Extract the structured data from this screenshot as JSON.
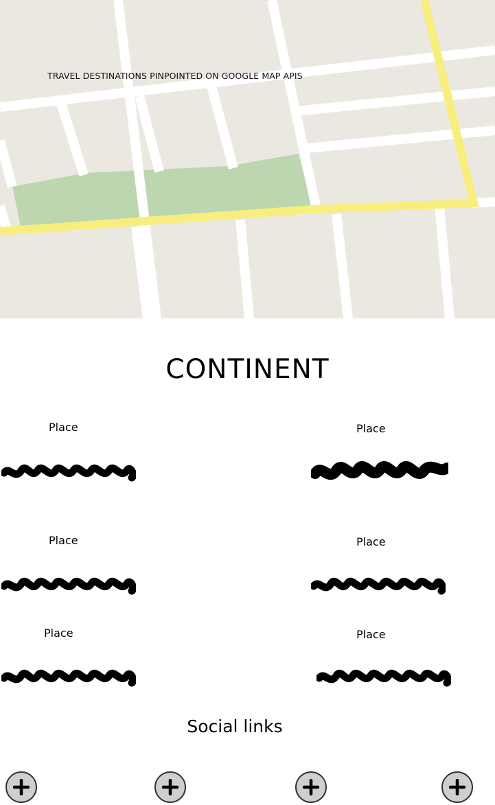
{
  "map": {
    "caption": "TRAVEL DESTINATIONS PINPOINTED ON GOOGLE MAP APIS",
    "colors": {
      "land": "#ebe8e2",
      "road": "#ffffff",
      "highway": "#f7ee7e",
      "park": "#bcd6b0"
    }
  },
  "continent": {
    "title": "CONTINENT"
  },
  "places": [
    {
      "label": "Place",
      "description_icon": "scribble-text-placeholder"
    },
    {
      "label": "Place",
      "description_icon": "scribble-text-placeholder"
    },
    {
      "label": "Place",
      "description_icon": "scribble-text-placeholder"
    },
    {
      "label": "Place",
      "description_icon": "scribble-text-placeholder"
    },
    {
      "label": "Place",
      "description_icon": "scribble-text-placeholder"
    },
    {
      "label": "Place",
      "description_icon": "scribble-text-placeholder"
    }
  ],
  "social": {
    "title": "Social links",
    "buttons": [
      {
        "icon": "plus-icon"
      },
      {
        "icon": "plus-icon"
      },
      {
        "icon": "plus-icon"
      },
      {
        "icon": "plus-icon"
      }
    ]
  }
}
